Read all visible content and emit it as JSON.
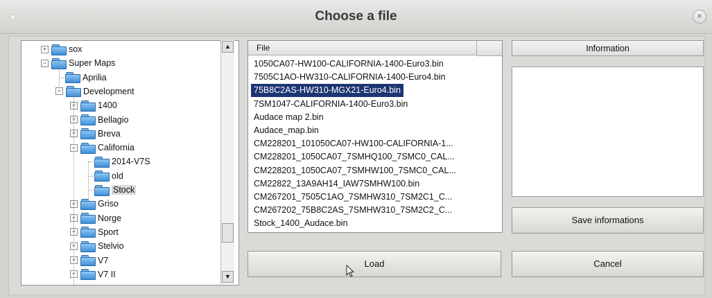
{
  "window": {
    "title": "Choose a file",
    "close_symbol": "×"
  },
  "tree": {
    "items": [
      {
        "label": "sox",
        "expander": "+"
      },
      {
        "label": "Super Maps",
        "expander": "−"
      },
      {
        "label": "Aprilia",
        "expander": ""
      },
      {
        "label": "Development",
        "expander": "−"
      },
      {
        "label": "1400",
        "expander": "+"
      },
      {
        "label": "Bellagio",
        "expander": "+"
      },
      {
        "label": "Breva",
        "expander": "+"
      },
      {
        "label": "California",
        "expander": "−"
      },
      {
        "label": "2014-V7S",
        "expander": ""
      },
      {
        "label": "old",
        "expander": ""
      },
      {
        "label": "Stock",
        "expander": "",
        "selected": true
      },
      {
        "label": "Griso",
        "expander": "+"
      },
      {
        "label": "Norge",
        "expander": "+"
      },
      {
        "label": "Sport",
        "expander": "+"
      },
      {
        "label": "Stelvio",
        "expander": "+"
      },
      {
        "label": "V7",
        "expander": "+"
      },
      {
        "label": "V7 II",
        "expander": "+"
      }
    ],
    "scroll_up": "▲",
    "scroll_down": "▼"
  },
  "file_list": {
    "column_header": "File",
    "files": [
      "1050CA07-HW100-CALIFORNIA-1400-Euro3.bin",
      "7505C1AO-HW310-CALIFORNIA-1400-Euro4.bin",
      "75B8C2AS-HW310-MGX21-Euro4.bin",
      "7SM1047-CALIFORNIA-1400-Euro3.bin",
      "Audace map 2.bin",
      "Audace_map.bin",
      "CM228201_101050CA07-HW100-CALIFORNIA-1...",
      "CM228201_1050CA07_7SMHQ100_7SMC0_CAL...",
      "CM228201_1050CA07_7SMHW100_7SMC0_CAL...",
      "CM22822_13A9AH14_IAW7SMHW100.bin",
      "CM267201_7505C1AO_7SMHW310_7SM2C1_C...",
      "CM267202_75B8C2AS_7SMHW310_7SM2C2_C...",
      "Stock_1400_Audace.bin"
    ],
    "selected_index": 2
  },
  "information": {
    "header": "Information"
  },
  "buttons": {
    "save": "Save informations",
    "load": "Load",
    "cancel": "Cancel"
  }
}
